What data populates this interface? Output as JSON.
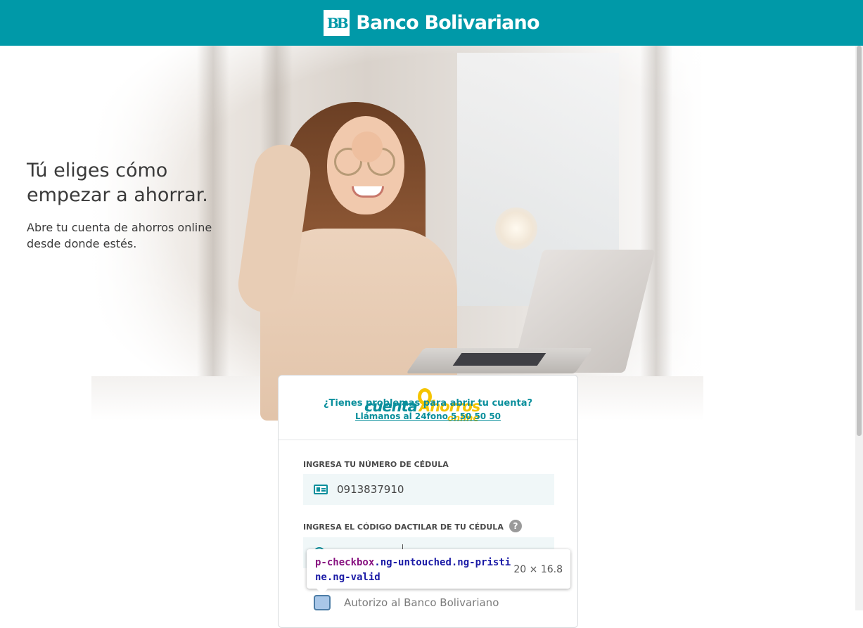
{
  "header": {
    "logo_mark": "BB",
    "brand_name": "Banco Bolivariano",
    "brand_color": "#0099a8"
  },
  "hero": {
    "headline_line1": "Tú eliges cómo",
    "headline_line2": "empezar a ahorrar.",
    "subline_line1": "Abre tu cuenta de ahorros online",
    "subline_line2": "desde donde estés."
  },
  "card": {
    "promo": {
      "logo_part1": "cuenta",
      "logo_part2": "Ahorros",
      "logo_part3": "online",
      "help_question": "¿Tienes problemas para abrir tu cuenta?",
      "help_call": "Llámanos al 24fono 5 50 50 50"
    },
    "cedula": {
      "label": "INGRESA TU NÚMERO DE CÉDULA",
      "value": "0913837910"
    },
    "dactilar": {
      "label": "INGRESA EL CÓDIGO DACTILAR DE TU CÉDULA",
      "help_icon": "?"
    },
    "consent": {
      "text": "Autorizo al Banco Bolivariano"
    }
  },
  "tooltip": {
    "tag": "p-checkbox",
    "classes_line1": ".ng-untouched.ng-pristi",
    "classes_line2": "ne.ng-valid",
    "size": "20 × 16.8"
  }
}
